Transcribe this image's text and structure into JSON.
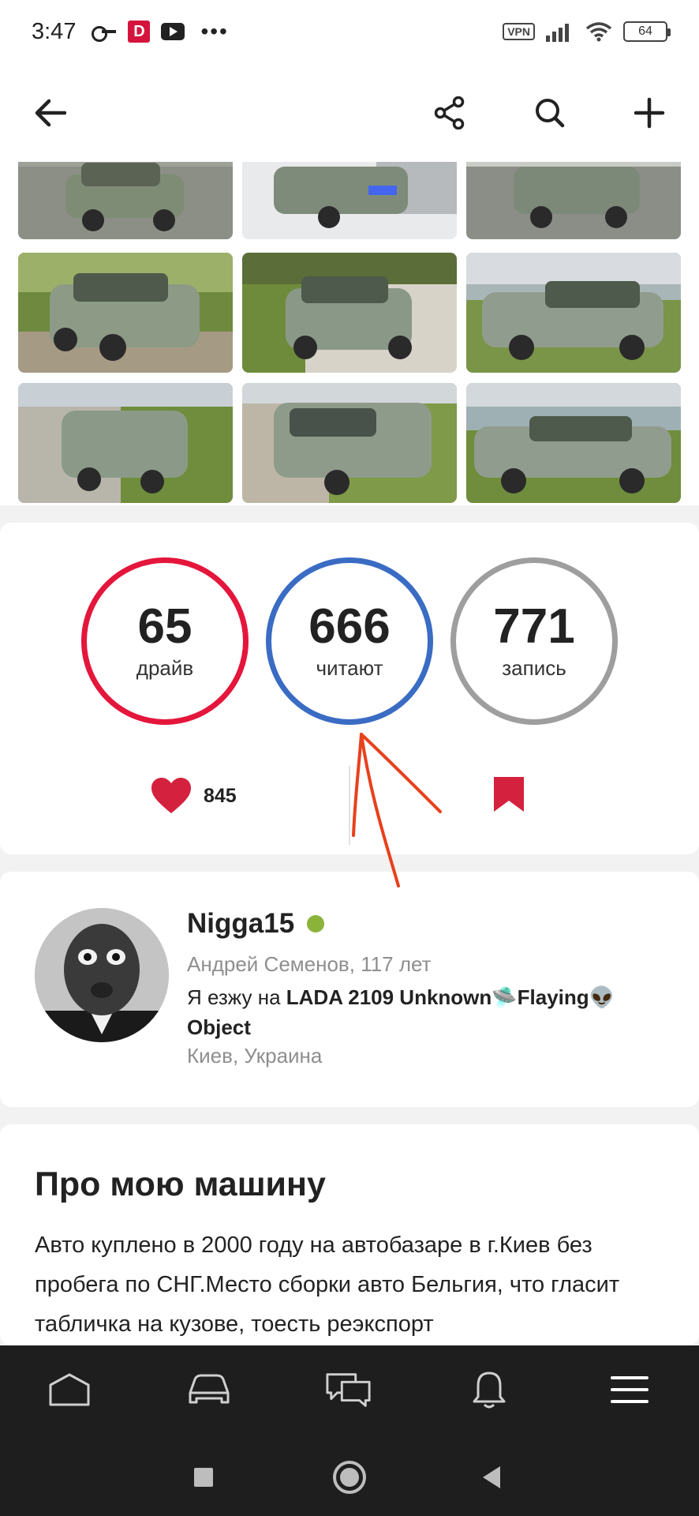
{
  "status_bar": {
    "time": "3:47",
    "vpn_label": "VPN",
    "battery": "64",
    "d_app_label": "D"
  },
  "app_bar": {
    "back_icon": "arrow-left-icon",
    "share_icon": "share-icon",
    "search_icon": "search-icon",
    "add_icon": "plus-icon"
  },
  "gallery": {
    "photo_count": 9
  },
  "stats": {
    "drive": {
      "value": "65",
      "label": "драйв",
      "color": "#e4163c"
    },
    "readers": {
      "value": "666",
      "label": "читают",
      "color": "#3a6cc4"
    },
    "posts": {
      "value": "771",
      "label": "запись",
      "color": "#9e9e9e"
    },
    "likes": "845",
    "heart_color": "#d4213d",
    "bookmark_color": "#d4213d"
  },
  "profile": {
    "username": "Nigga15",
    "online_color": "#8bb33a",
    "subtitle": "Андрей Семенов, 117 лет",
    "car_prefix": "Я езжу на ",
    "car_name": "LADA 2109 Unknown🛸Flaying👽 Object",
    "location": "Киев, Украина"
  },
  "about": {
    "title": "Про мою машину",
    "text": "Авто куплено в 2000 году на автобазаре в г.Киев без пробега по СНГ.Место сборки авто Бельгия, что гласит табличка на кузове, тоесть реэкспорт"
  },
  "bottom_nav": {
    "items": [
      "home-icon",
      "car-icon",
      "chat-icon",
      "bell-icon",
      "menu-icon"
    ]
  },
  "annotation": {
    "arrow_color": "#e8401c"
  }
}
